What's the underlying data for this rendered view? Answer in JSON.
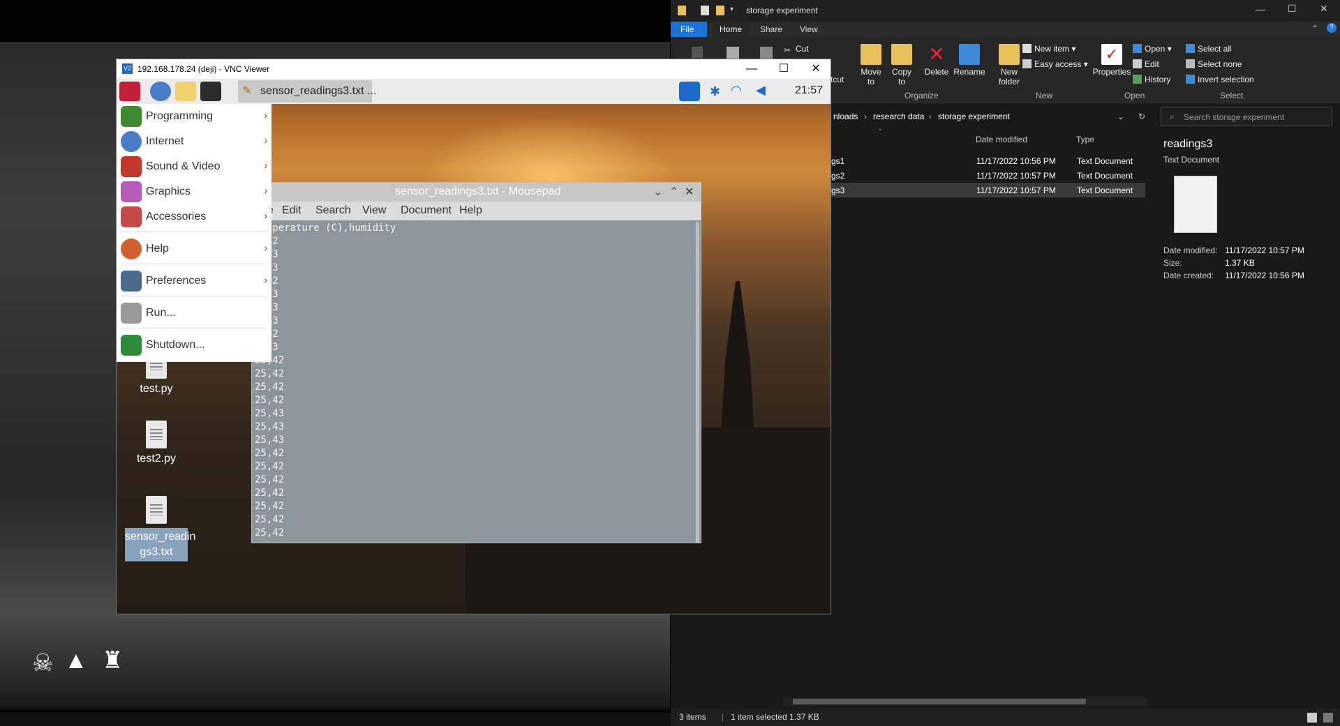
{
  "vnc": {
    "title": "192.168.178.24 (deji) - VNC Viewer",
    "logo": "V2",
    "minimize_icon": "—",
    "maximize_icon": "☐",
    "close_icon": "✕"
  },
  "panel": {
    "task_label": "sensor_readings3.txt ...",
    "clock": "21:57",
    "icons": [
      "raspberry-icon",
      "browser-icon",
      "file-manager-icon",
      "terminal-icon",
      "vnc-icon",
      "bluetooth-icon",
      "wifi-icon",
      "volume-icon"
    ]
  },
  "menu": {
    "items": [
      {
        "label": "Programming",
        "arrow": "›",
        "color": "#3c8a2e"
      },
      {
        "label": "Internet",
        "arrow": "›",
        "color": "#4a7cc7"
      },
      {
        "label": "Sound & Video",
        "arrow": "›",
        "color": "#c0392b"
      },
      {
        "label": "Graphics",
        "arrow": "›",
        "color": "#b85ab8"
      },
      {
        "label": "Accessories",
        "arrow": "›",
        "color": "#c44a4a"
      },
      {
        "label": "Help",
        "arrow": "›",
        "color": "#d06030"
      },
      {
        "label": "Preferences",
        "arrow": "›",
        "color": "#4c6a8c"
      },
      {
        "label": "Run...",
        "arrow": "",
        "color": "#999999"
      },
      {
        "label": "Shutdown...",
        "arrow": "",
        "color": "#2e8b3a"
      }
    ]
  },
  "desktop_files": [
    {
      "name": "test.py"
    },
    {
      "name": "test2.py"
    },
    {
      "name": "sensor_readin\ngs3.txt",
      "selected": true
    }
  ],
  "mousepad": {
    "title": "sensor_readings3.txt - Mousepad",
    "controls": [
      "⌄",
      "⌃",
      "✕"
    ],
    "menu": [
      "e",
      "Edit",
      "Search",
      "View",
      "Document",
      "Help"
    ],
    "content": "  nperature (C),humidity\n ,42\n ,43\n ,43\n ,42\n ,43\n ,43\n ,43\n ,42\n ,43\n25,42\n25,42\n25,42\n25,42\n25,43\n25,43\n25,43\n25,42\n25,42\n25,42\n25,42\n25,42\n25,42\n25,42"
  },
  "explorer": {
    "title": "storage experiment",
    "tabs": [
      "File",
      "Home",
      "Share",
      "View"
    ],
    "ribbon": {
      "cut": "Cut",
      "shortcut_fragment": "rtcut",
      "move_to": "Move\nto",
      "copy_to": "Copy\nto",
      "delete": "Delete",
      "rename": "Rename",
      "new_folder": "New\nfolder",
      "new_item": "New item",
      "easy_access": "Easy access",
      "properties": "Properties",
      "open": "Open",
      "edit": "Edit",
      "history": "History",
      "select_all": "Select all",
      "select_none": "Select none",
      "invert_selection": "Invert selection",
      "groups": [
        "Organize",
        "New",
        "Open",
        "Select"
      ]
    },
    "breadcrumb": [
      "nloads",
      "research data",
      "storage experiment"
    ],
    "search_placeholder": "Search storage experiment",
    "columns": {
      "date": "Date modified",
      "type": "Type"
    },
    "rows": [
      {
        "name": "gs1",
        "date": "11/17/2022 10:56 PM",
        "type": "Text Document"
      },
      {
        "name": "gs2",
        "date": "11/17/2022 10:57 PM",
        "type": "Text Document"
      },
      {
        "name": "gs3",
        "date": "11/17/2022 10:57 PM",
        "type": "Text Document",
        "selected": true
      }
    ],
    "preview": {
      "name": "readings3",
      "kind": "Text Document",
      "date_modified_label": "Date modified:",
      "date_modified": "11/17/2022 10:57 PM",
      "size_label": "Size:",
      "size": "1.37 KB",
      "date_created_label": "Date created:",
      "date_created": "11/17/2022 10:56 PM"
    },
    "status": {
      "items": "3 items",
      "selected": "1 item selected  1.37 KB"
    }
  }
}
